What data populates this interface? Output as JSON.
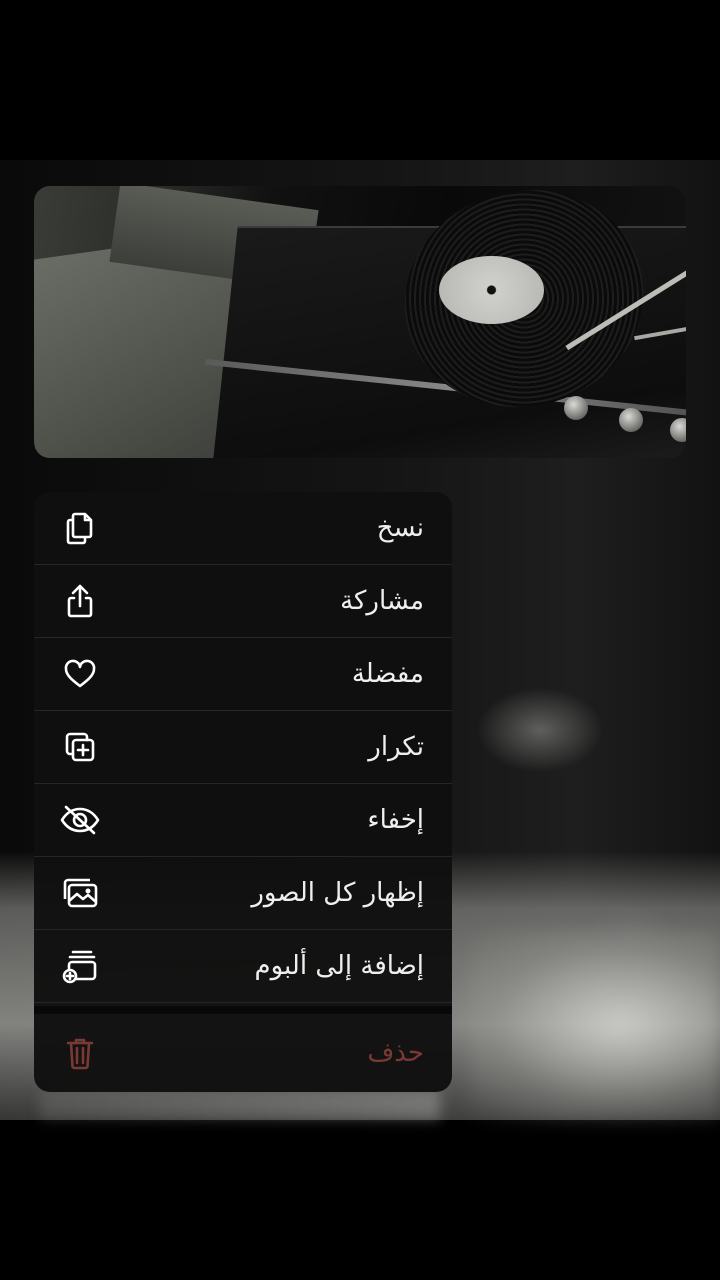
{
  "preview": {
    "description": "turntable-photo"
  },
  "menu": {
    "items": [
      {
        "label": "نسخ",
        "icon": "copy-icon"
      },
      {
        "label": "مشاركة",
        "icon": "share-icon"
      },
      {
        "label": "مفضلة",
        "icon": "heart-icon"
      },
      {
        "label": "تكرار",
        "icon": "duplicate-icon"
      },
      {
        "label": "إخفاء",
        "icon": "eye-slash-icon"
      },
      {
        "label": "إظهار كل الصور",
        "icon": "photos-icon"
      },
      {
        "label": "إضافة إلى ألبوم",
        "icon": "add-to-album-icon"
      }
    ],
    "delete": {
      "label": "حذف",
      "icon": "trash-icon",
      "color": "#7a3a34"
    }
  },
  "colors": {
    "menu_bg": "#101010",
    "text": "#efefef",
    "destructive": "#7a3a34"
  }
}
